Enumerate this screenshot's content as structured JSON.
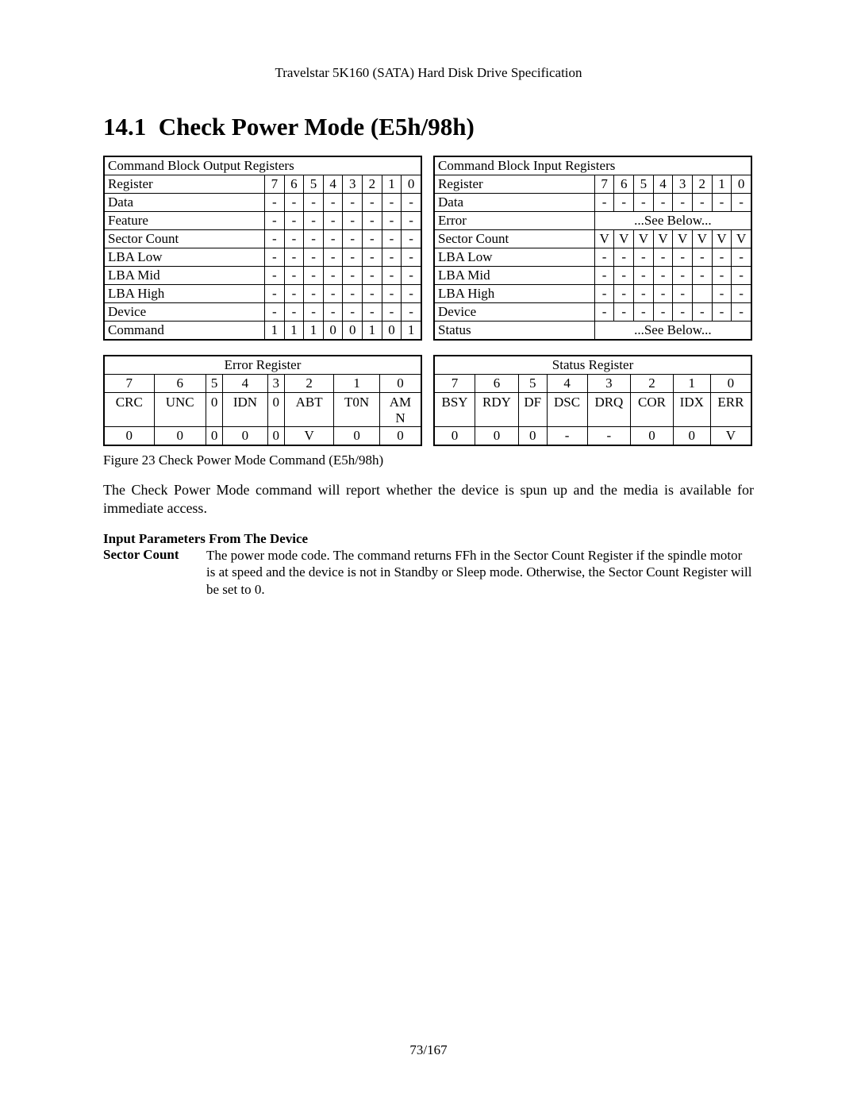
{
  "header": "Travelstar 5K160 (SATA) Hard Disk Drive Specification",
  "section_number": "14.1",
  "section_title": "Check Power Mode (E5h/98h)",
  "output_block": {
    "title": "Command Block Output Registers",
    "reg_header": "Register",
    "bits": [
      "7",
      "6",
      "5",
      "4",
      "3",
      "2",
      "1",
      "0"
    ],
    "rows": [
      {
        "name": "Data",
        "cells": [
          "-",
          "-",
          "-",
          "-",
          "-",
          "-",
          "-",
          "-"
        ]
      },
      {
        "name": "Feature",
        "cells": [
          "-",
          "-",
          "-",
          "-",
          "-",
          "-",
          "-",
          "-"
        ]
      },
      {
        "name": "Sector Count",
        "cells": [
          "-",
          "-",
          "-",
          "-",
          "-",
          "-",
          "-",
          "-"
        ]
      },
      {
        "name": "LBA Low",
        "cells": [
          "-",
          "-",
          "-",
          "-",
          "-",
          "-",
          "-",
          "-"
        ]
      },
      {
        "name": "LBA Mid",
        "cells": [
          "-",
          "-",
          "-",
          "-",
          "-",
          "-",
          "-",
          "-"
        ]
      },
      {
        "name": "LBA High",
        "cells": [
          "-",
          "-",
          "-",
          "-",
          "-",
          "-",
          "-",
          "-"
        ]
      },
      {
        "name": "Device",
        "cells": [
          "-",
          "-",
          "-",
          "-",
          "-",
          "-",
          "-",
          "-"
        ]
      },
      {
        "name": "Command",
        "cells": [
          "1",
          "1",
          "1",
          "0",
          "0",
          "1",
          "0",
          "1"
        ]
      }
    ]
  },
  "input_block": {
    "title": "Command Block Input Registers",
    "reg_header": "Register",
    "bits": [
      "7",
      "6",
      "5",
      "4",
      "3",
      "2",
      "1",
      "0"
    ],
    "rows": [
      {
        "name": "Data",
        "type": "cells",
        "cells": [
          "-",
          "-",
          "-",
          "-",
          "-",
          "-",
          "-",
          "-"
        ]
      },
      {
        "name": "Error",
        "type": "span",
        "span": "...See Below..."
      },
      {
        "name": "Sector Count",
        "type": "cells",
        "cells": [
          "V",
          "V",
          "V",
          "V",
          "V",
          "V",
          "V",
          "V"
        ]
      },
      {
        "name": "LBA Low",
        "type": "cells",
        "cells": [
          "-",
          "-",
          "-",
          "-",
          "-",
          "-",
          "-",
          "-"
        ]
      },
      {
        "name": "LBA Mid",
        "type": "cells",
        "cells": [
          "-",
          "-",
          "-",
          "-",
          "-",
          "-",
          "-",
          "-"
        ]
      },
      {
        "name": "LBA High",
        "type": "cells",
        "cells": [
          "-",
          "-",
          "-",
          "-",
          "-",
          "",
          "-",
          "-"
        ]
      },
      {
        "name": "Device",
        "type": "cells",
        "cells": [
          "-",
          "-",
          "-",
          "-",
          "-",
          "-",
          "-",
          "-"
        ]
      },
      {
        "name": "Status",
        "type": "span",
        "span": "...See Below..."
      }
    ]
  },
  "error_register": {
    "title": "Error Register",
    "bits": [
      "7",
      "6",
      "5",
      "4",
      "3",
      "2",
      "1",
      "0"
    ],
    "labels": [
      "CRC",
      "UNC",
      "0",
      "IDN",
      "0",
      "ABT",
      "T0N",
      "AMN"
    ],
    "values": [
      "0",
      "0",
      "0",
      "0",
      "0",
      "V",
      "0",
      "0"
    ]
  },
  "status_register": {
    "title": "Status Register",
    "bits": [
      "7",
      "6",
      "5",
      "4",
      "3",
      "2",
      "1",
      "0"
    ],
    "labels": [
      "BSY",
      "RDY",
      "DF",
      "DSC",
      "DRQ",
      "COR",
      "IDX",
      "ERR"
    ],
    "values": [
      "0",
      "0",
      "0",
      "-",
      "-",
      "0",
      "0",
      "V"
    ]
  },
  "figure_caption": "Figure 23 Check Power Mode Command (E5h/98h)",
  "body_text": "The Check Power Mode command will report whether the device is spun up and the media is available for immediate access.",
  "input_params_heading": "Input Parameters From The Device",
  "sector_count_label": "Sector Count",
  "sector_count_desc": "The power mode code. The command returns FFh in the Sector Count Register if the spindle motor is at speed and the device is not in Standby or Sleep mode. Otherwise, the Sector Count Register will be set to 0.",
  "page_number": "73/167"
}
